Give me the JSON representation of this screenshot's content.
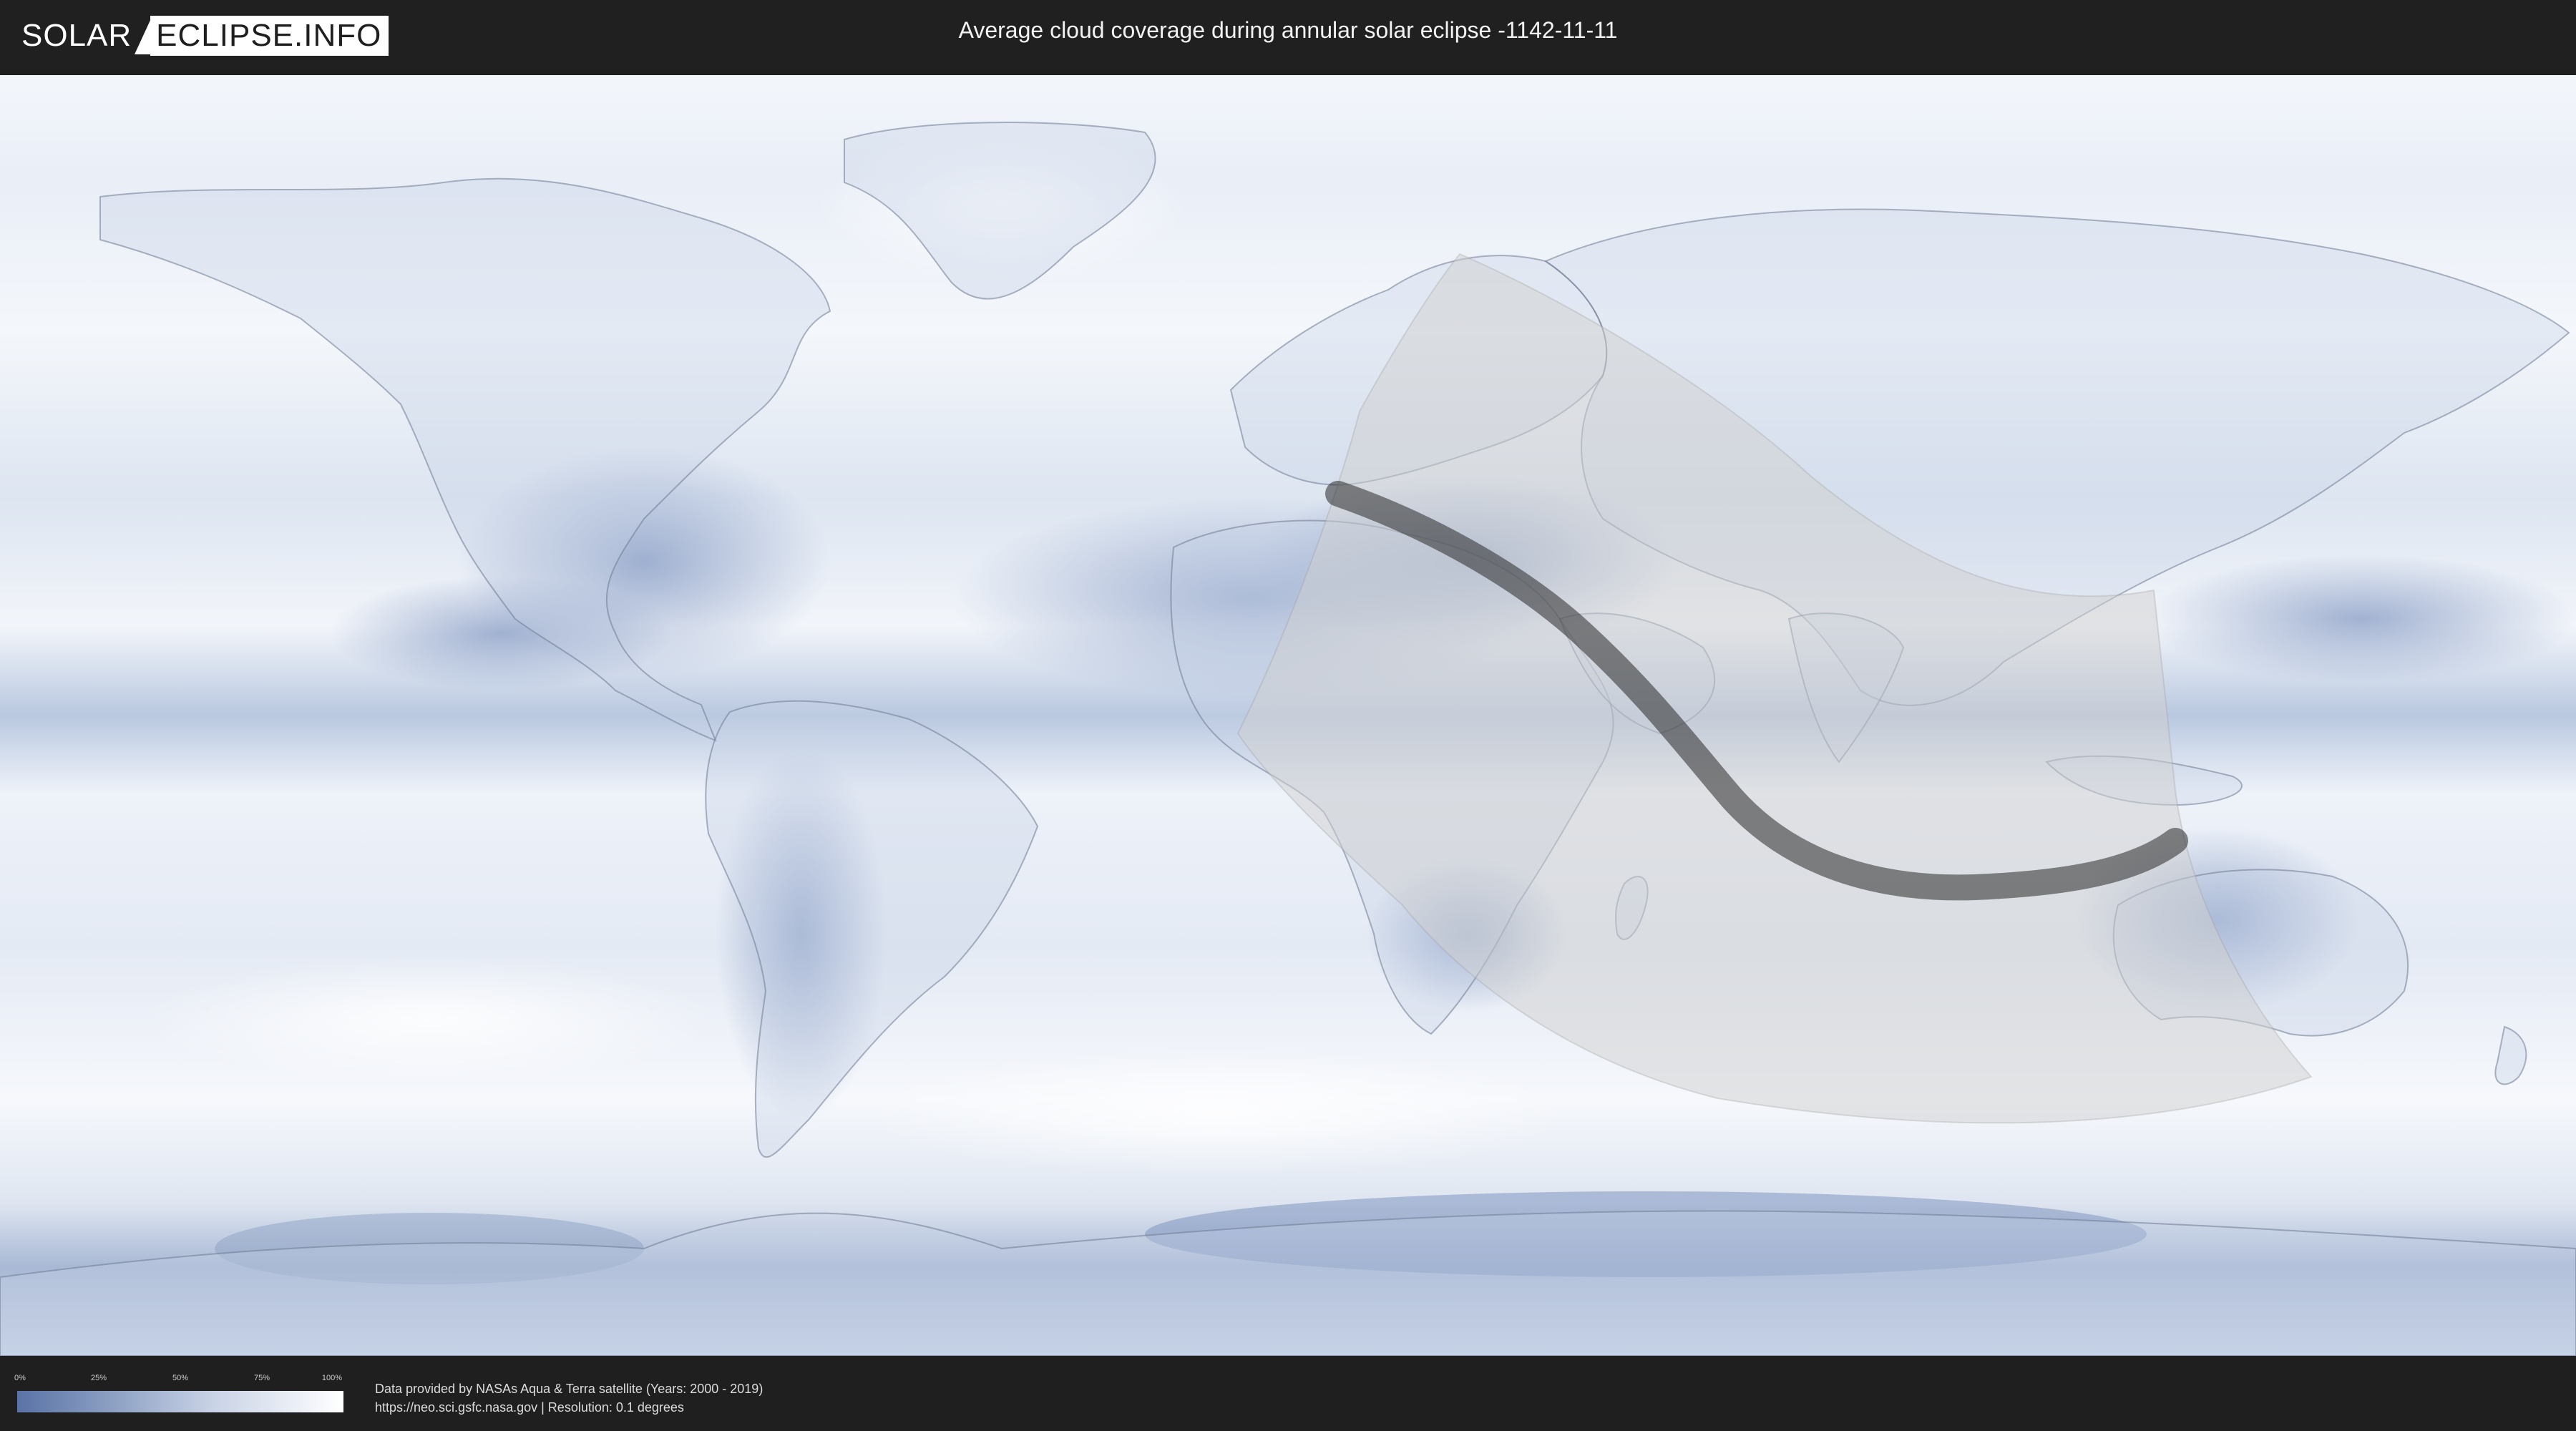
{
  "header": {
    "logo_part1": "SOLAR",
    "logo_part2": "ECLIPSE.INFO",
    "title": "Average cloud coverage during annular solar eclipse -1142-11-11"
  },
  "legend": {
    "ticks": [
      "0%",
      "25%",
      "50%",
      "75%",
      "100%"
    ]
  },
  "footer": {
    "credit_line1": "Data provided by NASAs Aqua & Terra satellite (Years: 2000 - 2019)",
    "credit_line2": "https://neo.sci.gsfc.nasa.gov | Resolution: 0.1 degrees"
  },
  "colors": {
    "cloud_high": "#ffffff",
    "cloud_low": "#5a73a6",
    "eclipse_shadow": "#2a2a2a",
    "penumbra": "#cfcfcf"
  },
  "icons": {
    "logo": "solar-eclipse-logo"
  }
}
